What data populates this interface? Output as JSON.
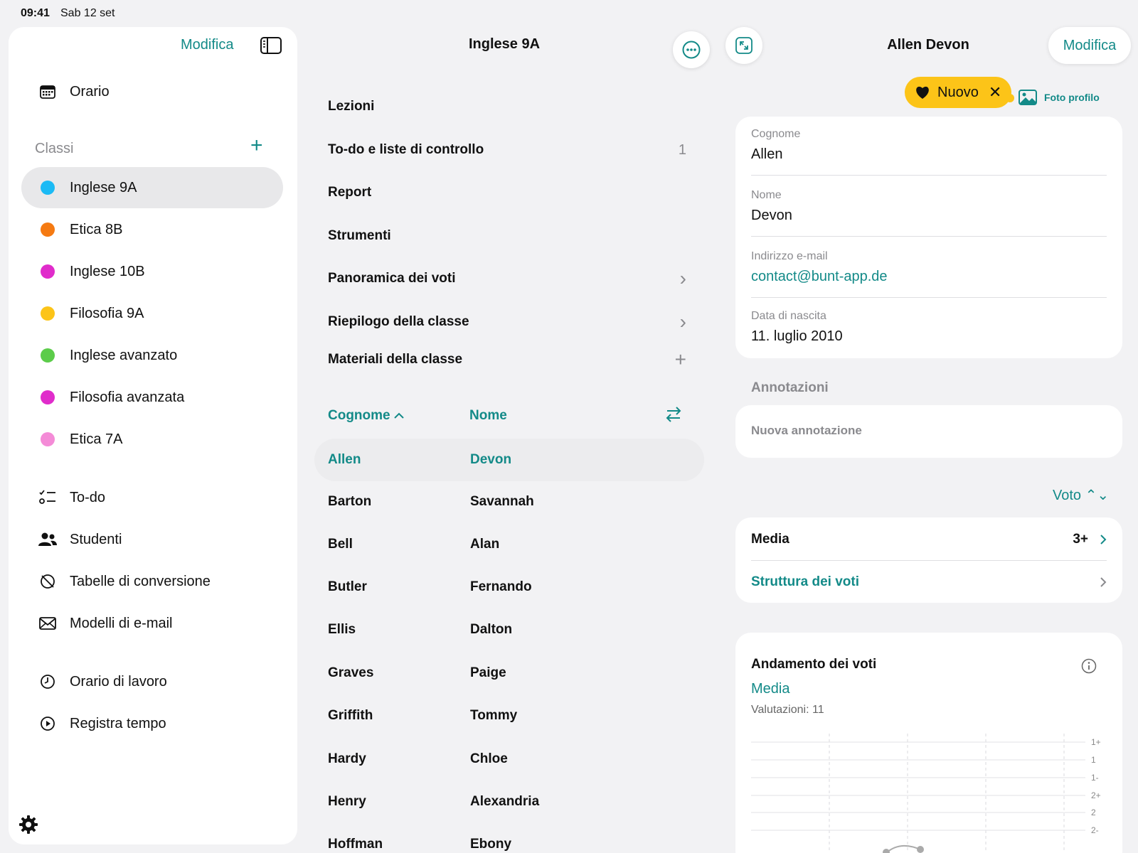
{
  "status": {
    "time": "09:41",
    "date": "Sab 12 set"
  },
  "sidebar": {
    "edit_label": "Modifica",
    "schedule": "Orario",
    "classes_title": "Classi",
    "classes": [
      {
        "label": "Inglese 9A",
        "color": "#1bbaf5",
        "active": true
      },
      {
        "label": "Etica 8B",
        "color": "#f57a12"
      },
      {
        "label": "Inglese 10B",
        "color": "#e02ccb"
      },
      {
        "label": "Filosofia 9A",
        "color": "#fcc418"
      },
      {
        "label": "Inglese avanzato",
        "color": "#5ccc4a"
      },
      {
        "label": "Filosofia avanzata",
        "color": "#e02ccb"
      },
      {
        "label": "Etica 7A",
        "color": "#f48bd7"
      }
    ],
    "tools": [
      {
        "label": "To-do",
        "icon": "checklist-icon"
      },
      {
        "label": "Studenti",
        "icon": "people-icon"
      },
      {
        "label": "Tabelle di conversione",
        "icon": "conversion-icon"
      },
      {
        "label": "Modelli di e-mail",
        "icon": "envelope-icon"
      }
    ],
    "time": [
      {
        "label": "Orario di lavoro",
        "icon": "clock-icon"
      },
      {
        "label": "Registra tempo",
        "icon": "play-icon"
      }
    ]
  },
  "middle": {
    "title": "Inglese 9A",
    "menu": [
      {
        "label": "Lezioni",
        "right": ""
      },
      {
        "label": "To-do e liste di controllo",
        "right": "1"
      },
      {
        "label": "Report",
        "right": ""
      },
      {
        "label": "Strumenti",
        "right": ""
      },
      {
        "label": "Panoramica dei voti",
        "right": "›"
      },
      {
        "label": "Riepilogo della classe",
        "right": "›"
      },
      {
        "label": "Materiali della classe",
        "right": "+"
      }
    ],
    "col_last": "Cognome",
    "col_first": "Nome",
    "students": [
      {
        "last": "Allen",
        "first": "Devon",
        "active": true
      },
      {
        "last": "Barton",
        "first": "Savannah"
      },
      {
        "last": "Bell",
        "first": "Alan"
      },
      {
        "last": "Butler",
        "first": "Fernando"
      },
      {
        "last": "Ellis",
        "first": "Dalton"
      },
      {
        "last": "Graves",
        "first": "Paige"
      },
      {
        "last": "Griffith",
        "first": "Tommy"
      },
      {
        "last": "Hardy",
        "first": "Chloe"
      },
      {
        "last": "Henry",
        "first": "Alexandria"
      },
      {
        "last": "Hoffman",
        "first": "Ebony"
      }
    ]
  },
  "detail": {
    "title": "Allen Devon",
    "edit_label": "Modifica",
    "tip_label": "Nuovo",
    "photo_label": "Foto profilo",
    "fields": [
      {
        "label": "Cognome",
        "value": "Allen"
      },
      {
        "label": "Nome",
        "value": "Devon"
      },
      {
        "label": "Indirizzo e-mail",
        "value": "contact@bunt-app.de"
      },
      {
        "label": "Data di nascita",
        "value": "11. luglio 2010"
      }
    ],
    "notes_title": "Annotazioni",
    "notes_placeholder": "Nuova annotazione",
    "grade_selector": "Voto ⌃⌄",
    "average_label": "Media",
    "average_value": "3+",
    "structure_label": "Struttura dei voti",
    "trend_title": "Andamento dei voti",
    "trend_series": "Media",
    "trend_count": "Valutazioni: 11",
    "axis_ticks": [
      "1+",
      "1",
      "1-",
      "2+",
      "2",
      "2-"
    ]
  }
}
